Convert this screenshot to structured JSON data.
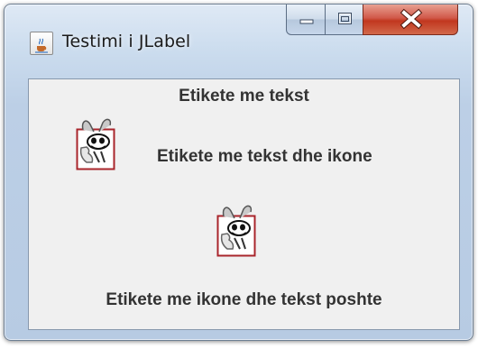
{
  "window": {
    "title": "Testimi i JLabel",
    "icon": "java-cup-icon",
    "controls": {
      "minimize_icon": "minimize-icon",
      "maximize_icon": "maximize-icon",
      "close_icon": "close-icon"
    }
  },
  "labels": {
    "text_label": "Etikete me tekst",
    "text_icon_label": "Etikete me tekst dhe ikone",
    "icon_text_below_label": "Etikete me ikone dhe tekst poshte"
  },
  "icons": {
    "label_icon": "bug-icon"
  },
  "colors": {
    "content_background": "#f0f0f0",
    "label_text": "#333333",
    "close_button": "#c1371f",
    "icon_frame": "#a9252b"
  }
}
